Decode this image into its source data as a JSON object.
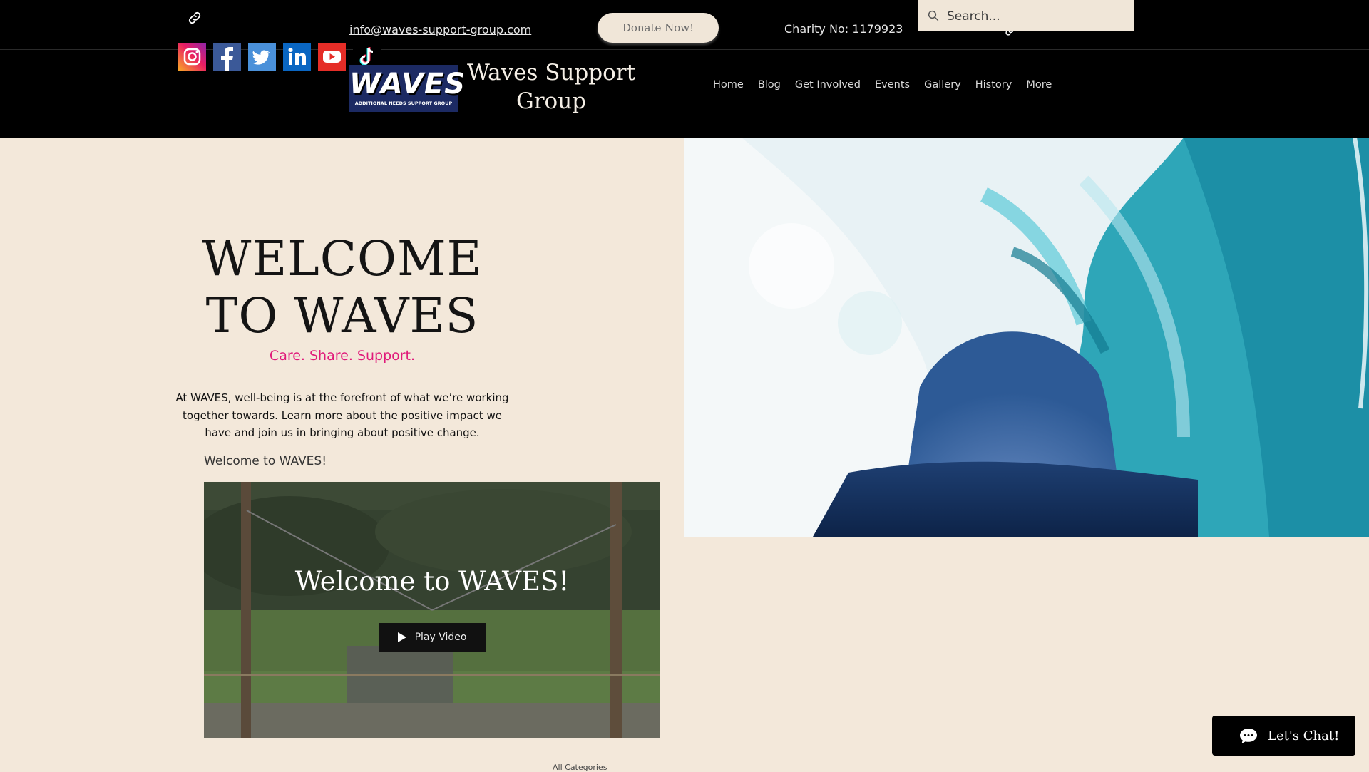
{
  "header": {
    "email": "info@waves-support-group.com",
    "donate_label": "Donate Now!",
    "charity": "Charity No: 1179923",
    "search_placeholder": "Search...",
    "site_title": "Waves Support Group",
    "logo_text": "WAVES",
    "logo_subtext": "ADDITIONAL NEEDS SUPPORT GROUP",
    "nav": [
      "Home",
      "Blog",
      "Get Involved",
      "Events",
      "Gallery",
      "History",
      "More"
    ],
    "social_icons": [
      "instagram-icon",
      "facebook-icon",
      "twitter-icon",
      "linkedin-icon",
      "youtube-icon",
      "tiktok-icon"
    ]
  },
  "hero": {
    "title_line1": "WELCOME",
    "title_line2": "TO WAVES",
    "tagline": "Care. Share. Support.",
    "intro": "At WAVES, well-being is at the forefront of what we’re working together towards. Learn more about the positive impact we have and join us in bringing about positive change."
  },
  "video": {
    "label": "Welcome to WAVES!",
    "title": "Welcome to WAVES!",
    "play_label": "Play Video"
  },
  "blog": {
    "categories": "All Categories"
  },
  "chat": {
    "label": "Let's Chat!"
  },
  "colors": {
    "accent": "#e0197a",
    "background": "#f3e8da",
    "header": "#000000",
    "logo_bg": "#1c2a63"
  }
}
